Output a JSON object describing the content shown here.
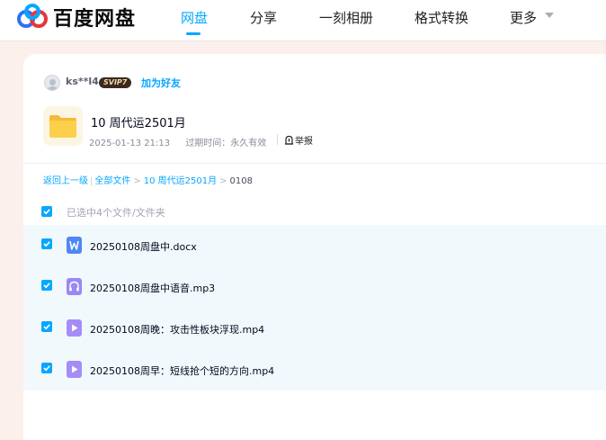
{
  "header": {
    "brand": "百度网盘",
    "nav": [
      {
        "label": "网盘",
        "active": true
      },
      {
        "label": "分享",
        "active": false
      },
      {
        "label": "一刻相册",
        "active": false
      },
      {
        "label": "格式转换",
        "active": false
      },
      {
        "label": "更多",
        "active": false
      }
    ],
    "accent_color": "#06a7ff"
  },
  "sharer": {
    "username": "ks**l4",
    "badge": "SVIP7",
    "add_friend": "加为好友"
  },
  "share": {
    "title": "10 周代运2501月",
    "date": "2025-01-13 21:13",
    "expiry": "过期时间：永久有效",
    "report": "举报",
    "icon": "folder-icon"
  },
  "breadcrumb": {
    "back": "返回上一级",
    "items": [
      "全部文件",
      "10 周代运2501月"
    ],
    "current": "0108"
  },
  "selection": {
    "label": "已选中4个文件/文件夹",
    "checked": true
  },
  "files": [
    {
      "name": "20250108周盘中.docx",
      "icon": "word-doc-icon",
      "checked": true
    },
    {
      "name": "20250108周盘中语音.mp3",
      "icon": "audio-file-icon",
      "checked": true
    },
    {
      "name": "20250108周晚：攻击性板块浮现.mp4",
      "icon": "video-file-icon",
      "checked": true
    },
    {
      "name": "20250108周早：短线抢个短的方向.mp4",
      "icon": "video-file-icon",
      "checked": true
    }
  ]
}
